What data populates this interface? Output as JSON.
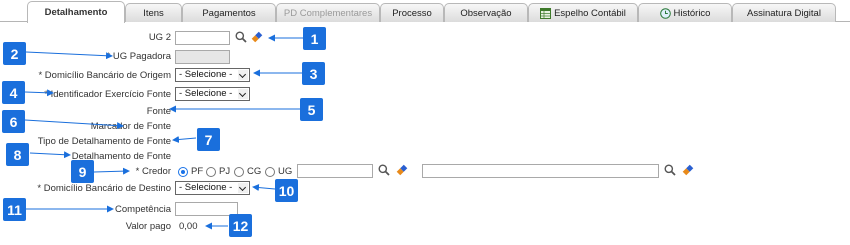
{
  "tabs": [
    {
      "label": "Detalhamento",
      "state": "active"
    },
    {
      "label": "Itens",
      "state": "normal"
    },
    {
      "label": "Pagamentos",
      "state": "normal"
    },
    {
      "label": "PD Complementares",
      "state": "disabled"
    },
    {
      "label": "Processo",
      "state": "normal"
    },
    {
      "label": "Observação",
      "state": "normal"
    },
    {
      "label": "Espelho Contábil",
      "state": "normal",
      "icon": "spreadsheet-icon"
    },
    {
      "label": "Histórico",
      "state": "normal",
      "icon": "history-icon"
    },
    {
      "label": "Assinatura Digital",
      "state": "normal"
    }
  ],
  "form": {
    "ug2_label": "UG 2",
    "ug_pagadora_label": "* UG Pagadora",
    "domicilio_origem_label": "* Domicílio Bancário de Origem",
    "domicilio_origem_value": "- Selecione -",
    "identificador_label": "* Identificador Exercício Fonte",
    "identificador_value": "- Selecione -",
    "fonte_label": "Fonte",
    "marcador_label": "Marcador de Fonte",
    "tipo_detalhamento_label": "Tipo de Detalhamento de Fonte",
    "detalhamento_label": "Detalhamento de Fonte",
    "credor_label": "* Credor",
    "credor_options": [
      "PF",
      "PJ",
      "CG",
      "UG"
    ],
    "credor_selected": "PF",
    "domicilio_destino_label": "* Domicílio Bancário de Destino",
    "domicilio_destino_value": "- Selecione -",
    "competencia_label": "Competência",
    "valor_pago_label": "Valor pago",
    "valor_pago_value": "0,00"
  },
  "callouts": [
    "1",
    "2",
    "3",
    "4",
    "5",
    "6",
    "7",
    "8",
    "9",
    "10",
    "11",
    "12"
  ],
  "colors": {
    "callout": "#1a6fdc",
    "radio_selected": "#1a73e8",
    "tab_border": "#b8b8b8"
  }
}
